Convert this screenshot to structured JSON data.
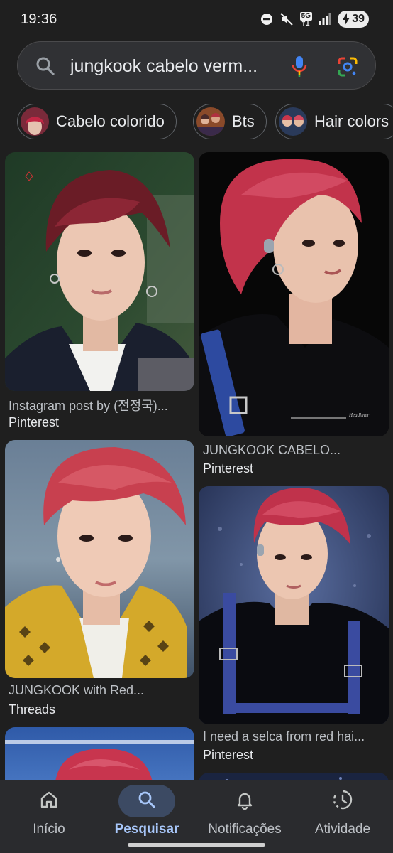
{
  "status_bar": {
    "time": "19:36",
    "network": "5G",
    "battery": "39",
    "icons": [
      "do-not-disturb-icon",
      "mute-icon",
      "5g-icon",
      "signal-icon",
      "battery-icon"
    ]
  },
  "search": {
    "query": "jungkook cabelo verm..."
  },
  "chips": [
    {
      "label": "Cabelo colorido"
    },
    {
      "label": "Bts"
    },
    {
      "label": "Hair colors"
    }
  ],
  "results": [
    {
      "caption": "Instagram post by (전정국)...",
      "source": "Pinterest"
    },
    {
      "caption": "JUNGKOOK CABELO...",
      "source": "Pinterest"
    },
    {
      "caption": "JUNGKOOK with Red...",
      "source": "Threads"
    },
    {
      "caption": "I need a selca from red hai...",
      "source": "Pinterest"
    }
  ],
  "watermarks": {
    "headliner": "Headliner"
  },
  "nav": [
    {
      "label": "Início",
      "icon": "home-icon"
    },
    {
      "label": "Pesquisar",
      "icon": "search-icon",
      "active": true
    },
    {
      "label": "Notificações",
      "icon": "bell-icon"
    },
    {
      "label": "Atividade",
      "icon": "activity-icon"
    }
  ],
  "colors": {
    "background": "#1f1f1f",
    "search_bar": "#303134",
    "accent_active": "#a8c7fa",
    "hair_red": "#b8384f"
  }
}
